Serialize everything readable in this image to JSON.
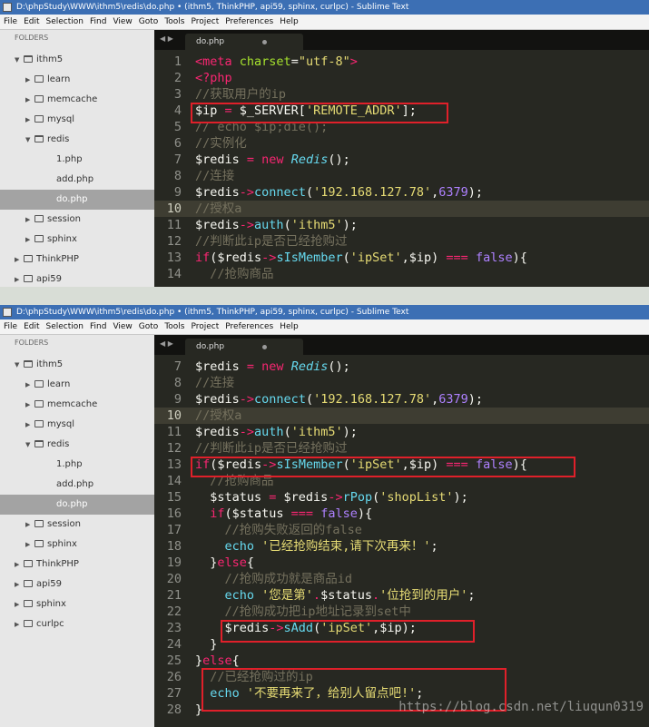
{
  "windows": [
    {
      "title": "D:\\phpStudy\\WWW\\ithm5\\redis\\do.php • (ithm5, ThinkPHP, api59, sphinx, curlpc) - Sublime Text",
      "menu": [
        "File",
        "Edit",
        "Selection",
        "Find",
        "View",
        "Goto",
        "Tools",
        "Project",
        "Preferences",
        "Help"
      ],
      "folders_label": "FOLDERS",
      "tab": "do.php",
      "tree": [
        {
          "label": "ithm5",
          "arrow": "▼",
          "icon": "open",
          "indent": 0
        },
        {
          "label": "learn",
          "arrow": "▶",
          "icon": "closed",
          "indent": 1
        },
        {
          "label": "memcache",
          "arrow": "▶",
          "icon": "closed",
          "indent": 1
        },
        {
          "label": "mysql",
          "arrow": "▶",
          "icon": "closed",
          "indent": 1
        },
        {
          "label": "redis",
          "arrow": "▼",
          "icon": "open",
          "indent": 1
        },
        {
          "label": "1.php",
          "arrow": "",
          "icon": "file",
          "indent": 2
        },
        {
          "label": "add.php",
          "arrow": "",
          "icon": "file",
          "indent": 2
        },
        {
          "label": "do.php",
          "arrow": "",
          "icon": "file",
          "indent": 2,
          "selected": true
        },
        {
          "label": "session",
          "arrow": "▶",
          "icon": "closed",
          "indent": 1
        },
        {
          "label": "sphinx",
          "arrow": "▶",
          "icon": "closed",
          "indent": 1
        },
        {
          "label": "ThinkPHP",
          "arrow": "▶",
          "icon": "closed",
          "indent": 0
        },
        {
          "label": "api59",
          "arrow": "▶",
          "icon": "closed",
          "indent": 0
        }
      ],
      "lines": [
        {
          "n": "1",
          "t": [
            [
              "t-tag",
              "<meta"
            ],
            [
              "t-p",
              " "
            ],
            [
              "t-attr",
              "charset"
            ],
            [
              "t-p",
              "="
            ],
            [
              "t-str",
              "\"utf-8\""
            ],
            [
              "t-tag",
              ">"
            ]
          ]
        },
        {
          "n": "2",
          "t": [
            [
              "t-tag",
              "<?php"
            ]
          ]
        },
        {
          "n": "3",
          "t": [
            [
              "t-cmt",
              "//获取用户的ip"
            ]
          ]
        },
        {
          "n": "4",
          "t": [
            [
              "t-var",
              "$ip"
            ],
            [
              "t-op",
              " = "
            ],
            [
              "t-var",
              "$_SERVER["
            ],
            [
              "t-str",
              "'REMOTE_ADDR'"
            ],
            [
              "t-var",
              "];"
            ]
          ]
        },
        {
          "n": "5",
          "t": [
            [
              "t-cmt",
              "// echo $ip;die();"
            ]
          ]
        },
        {
          "n": "6",
          "t": [
            [
              "t-cmt",
              "//实例化"
            ]
          ]
        },
        {
          "n": "7",
          "t": [
            [
              "t-var",
              "$redis"
            ],
            [
              "t-op",
              " = "
            ],
            [
              "t-kw",
              "new "
            ],
            [
              "t-cls",
              "Redis"
            ],
            [
              "t-var",
              "();"
            ]
          ]
        },
        {
          "n": "8",
          "t": [
            [
              "t-cmt",
              "//连接"
            ]
          ]
        },
        {
          "n": "9",
          "t": [
            [
              "t-var",
              "$redis"
            ],
            [
              "t-op",
              "->"
            ],
            [
              "t-fn",
              "connect"
            ],
            [
              "t-var",
              "("
            ],
            [
              "t-str",
              "'192.168.127.78'"
            ],
            [
              "t-var",
              ","
            ],
            [
              "t-num",
              "6379"
            ],
            [
              "t-var",
              ");"
            ]
          ]
        },
        {
          "n": "10",
          "cur": true,
          "t": [
            [
              "t-cmt",
              "//授权a"
            ]
          ]
        },
        {
          "n": "11",
          "t": [
            [
              "t-var",
              "$redis"
            ],
            [
              "t-op",
              "->"
            ],
            [
              "t-fn",
              "auth"
            ],
            [
              "t-var",
              "("
            ],
            [
              "t-str",
              "'ithm5'"
            ],
            [
              "t-var",
              ");"
            ]
          ]
        },
        {
          "n": "12",
          "t": [
            [
              "t-cmt",
              "//判断此ip是否已经抢购过"
            ]
          ]
        },
        {
          "n": "13",
          "t": [
            [
              "t-kw",
              "if"
            ],
            [
              "t-var",
              "($redis"
            ],
            [
              "t-op",
              "->"
            ],
            [
              "t-fn",
              "sIsMember"
            ],
            [
              "t-var",
              "("
            ],
            [
              "t-str",
              "'ipSet'"
            ],
            [
              "t-var",
              ",$ip) "
            ],
            [
              "t-op",
              "==="
            ],
            [
              "t-var",
              " "
            ],
            [
              "t-bool",
              "false"
            ],
            [
              "t-var",
              "){"
            ]
          ]
        },
        {
          "n": "14",
          "t": [
            [
              "t-cmt",
              "  //抢购商品"
            ]
          ]
        }
      ]
    },
    {
      "title": "D:\\phpStudy\\WWW\\ithm5\\redis\\do.php • (ithm5, ThinkPHP, api59, sphinx, curlpc) - Sublime Text",
      "menu": [
        "File",
        "Edit",
        "Selection",
        "Find",
        "View",
        "Goto",
        "Tools",
        "Project",
        "Preferences",
        "Help"
      ],
      "folders_label": "FOLDERS",
      "tab": "do.php",
      "tree": [
        {
          "label": "ithm5",
          "arrow": "▼",
          "icon": "open",
          "indent": 0
        },
        {
          "label": "learn",
          "arrow": "▶",
          "icon": "closed",
          "indent": 1
        },
        {
          "label": "memcache",
          "arrow": "▶",
          "icon": "closed",
          "indent": 1
        },
        {
          "label": "mysql",
          "arrow": "▶",
          "icon": "closed",
          "indent": 1
        },
        {
          "label": "redis",
          "arrow": "▼",
          "icon": "open",
          "indent": 1
        },
        {
          "label": "1.php",
          "arrow": "",
          "icon": "file",
          "indent": 2
        },
        {
          "label": "add.php",
          "arrow": "",
          "icon": "file",
          "indent": 2
        },
        {
          "label": "do.php",
          "arrow": "",
          "icon": "file",
          "indent": 2,
          "selected": true
        },
        {
          "label": "session",
          "arrow": "▶",
          "icon": "closed",
          "indent": 1
        },
        {
          "label": "sphinx",
          "arrow": "▶",
          "icon": "closed",
          "indent": 1
        },
        {
          "label": "ThinkPHP",
          "arrow": "▶",
          "icon": "closed",
          "indent": 0
        },
        {
          "label": "api59",
          "arrow": "▶",
          "icon": "closed",
          "indent": 0
        },
        {
          "label": "sphinx",
          "arrow": "▶",
          "icon": "closed",
          "indent": 0
        },
        {
          "label": "curlpc",
          "arrow": "▶",
          "icon": "closed",
          "indent": 0
        }
      ],
      "lines": [
        {
          "n": "7",
          "t": [
            [
              "t-var",
              "$redis"
            ],
            [
              "t-op",
              " = "
            ],
            [
              "t-kw",
              "new "
            ],
            [
              "t-cls",
              "Redis"
            ],
            [
              "t-var",
              "();"
            ]
          ]
        },
        {
          "n": "8",
          "t": [
            [
              "t-cmt",
              "//连接"
            ]
          ]
        },
        {
          "n": "9",
          "t": [
            [
              "t-var",
              "$redis"
            ],
            [
              "t-op",
              "->"
            ],
            [
              "t-fn",
              "connect"
            ],
            [
              "t-var",
              "("
            ],
            [
              "t-str",
              "'192.168.127.78'"
            ],
            [
              "t-var",
              ","
            ],
            [
              "t-num",
              "6379"
            ],
            [
              "t-var",
              ");"
            ]
          ]
        },
        {
          "n": "10",
          "cur": true,
          "t": [
            [
              "t-cmt",
              "//授权a"
            ]
          ]
        },
        {
          "n": "11",
          "t": [
            [
              "t-var",
              "$redis"
            ],
            [
              "t-op",
              "->"
            ],
            [
              "t-fn",
              "auth"
            ],
            [
              "t-var",
              "("
            ],
            [
              "t-str",
              "'ithm5'"
            ],
            [
              "t-var",
              ");"
            ]
          ]
        },
        {
          "n": "12",
          "t": [
            [
              "t-cmt",
              "//判断此ip是否已经抢购过"
            ]
          ]
        },
        {
          "n": "13",
          "t": [
            [
              "t-kw",
              "if"
            ],
            [
              "t-var",
              "($redis"
            ],
            [
              "t-op",
              "->"
            ],
            [
              "t-fn",
              "sIsMember"
            ],
            [
              "t-var",
              "("
            ],
            [
              "t-str",
              "'ipSet'"
            ],
            [
              "t-var",
              ",$ip) "
            ],
            [
              "t-op",
              "==="
            ],
            [
              "t-var",
              " "
            ],
            [
              "t-bool",
              "false"
            ],
            [
              "t-var",
              "){"
            ]
          ]
        },
        {
          "n": "14",
          "t": [
            [
              "t-cmt",
              "  //抢购商品"
            ]
          ]
        },
        {
          "n": "15",
          "t": [
            [
              "t-var",
              "  $status"
            ],
            [
              "t-op",
              " = "
            ],
            [
              "t-var",
              "$redis"
            ],
            [
              "t-op",
              "->"
            ],
            [
              "t-fn",
              "rPop"
            ],
            [
              "t-var",
              "("
            ],
            [
              "t-str",
              "'shopList'"
            ],
            [
              "t-var",
              ");"
            ]
          ]
        },
        {
          "n": "16",
          "t": [
            [
              "t-kw",
              "  if"
            ],
            [
              "t-var",
              "($status "
            ],
            [
              "t-op",
              "==="
            ],
            [
              "t-var",
              " "
            ],
            [
              "t-bool",
              "false"
            ],
            [
              "t-var",
              "){"
            ]
          ]
        },
        {
          "n": "17",
          "t": [
            [
              "t-cmt",
              "    //抢购失败返回的false"
            ]
          ]
        },
        {
          "n": "18",
          "t": [
            [
              "t-fn",
              "    echo "
            ],
            [
              "t-str",
              "'已经抢购结束,请下次再来！'"
            ],
            [
              "t-var",
              ";"
            ]
          ]
        },
        {
          "n": "19",
          "t": [
            [
              "t-var",
              "  }"
            ],
            [
              "t-kw",
              "else"
            ],
            [
              "t-var",
              "{"
            ]
          ]
        },
        {
          "n": "20",
          "t": [
            [
              "t-cmt",
              "    //抢购成功就是商品id"
            ]
          ]
        },
        {
          "n": "21",
          "t": [
            [
              "t-fn",
              "    echo "
            ],
            [
              "t-str",
              "'您是第'"
            ],
            [
              "t-op",
              "."
            ],
            [
              "t-var",
              "$status"
            ],
            [
              "t-op",
              "."
            ],
            [
              "t-str",
              "'位抢到的用户'"
            ],
            [
              "t-var",
              ";"
            ]
          ]
        },
        {
          "n": "22",
          "t": [
            [
              "t-cmt",
              "    //抢购成功把ip地址记录到set中"
            ]
          ]
        },
        {
          "n": "23",
          "t": [
            [
              "t-var",
              "    $redis"
            ],
            [
              "t-op",
              "->"
            ],
            [
              "t-fn",
              "sAdd"
            ],
            [
              "t-var",
              "("
            ],
            [
              "t-str",
              "'ipSet'"
            ],
            [
              "t-var",
              ",$ip);"
            ]
          ]
        },
        {
          "n": "24",
          "t": [
            [
              "t-var",
              "  }"
            ]
          ]
        },
        {
          "n": "25",
          "t": [
            [
              "t-var",
              "}"
            ],
            [
              "t-kw",
              "else"
            ],
            [
              "t-var",
              "{"
            ]
          ]
        },
        {
          "n": "26",
          "t": [
            [
              "t-cmt",
              "  //已经抢购过的ip"
            ]
          ]
        },
        {
          "n": "27",
          "t": [
            [
              "t-fn",
              "  echo "
            ],
            [
              "t-str",
              "'不要再来了，给别人留点吧!'"
            ],
            [
              "t-var",
              ";"
            ]
          ]
        },
        {
          "n": "28",
          "t": [
            [
              "t-var",
              "}"
            ]
          ]
        }
      ]
    }
  ],
  "watermark": "https://blog.csdn.net/liuqun0319"
}
